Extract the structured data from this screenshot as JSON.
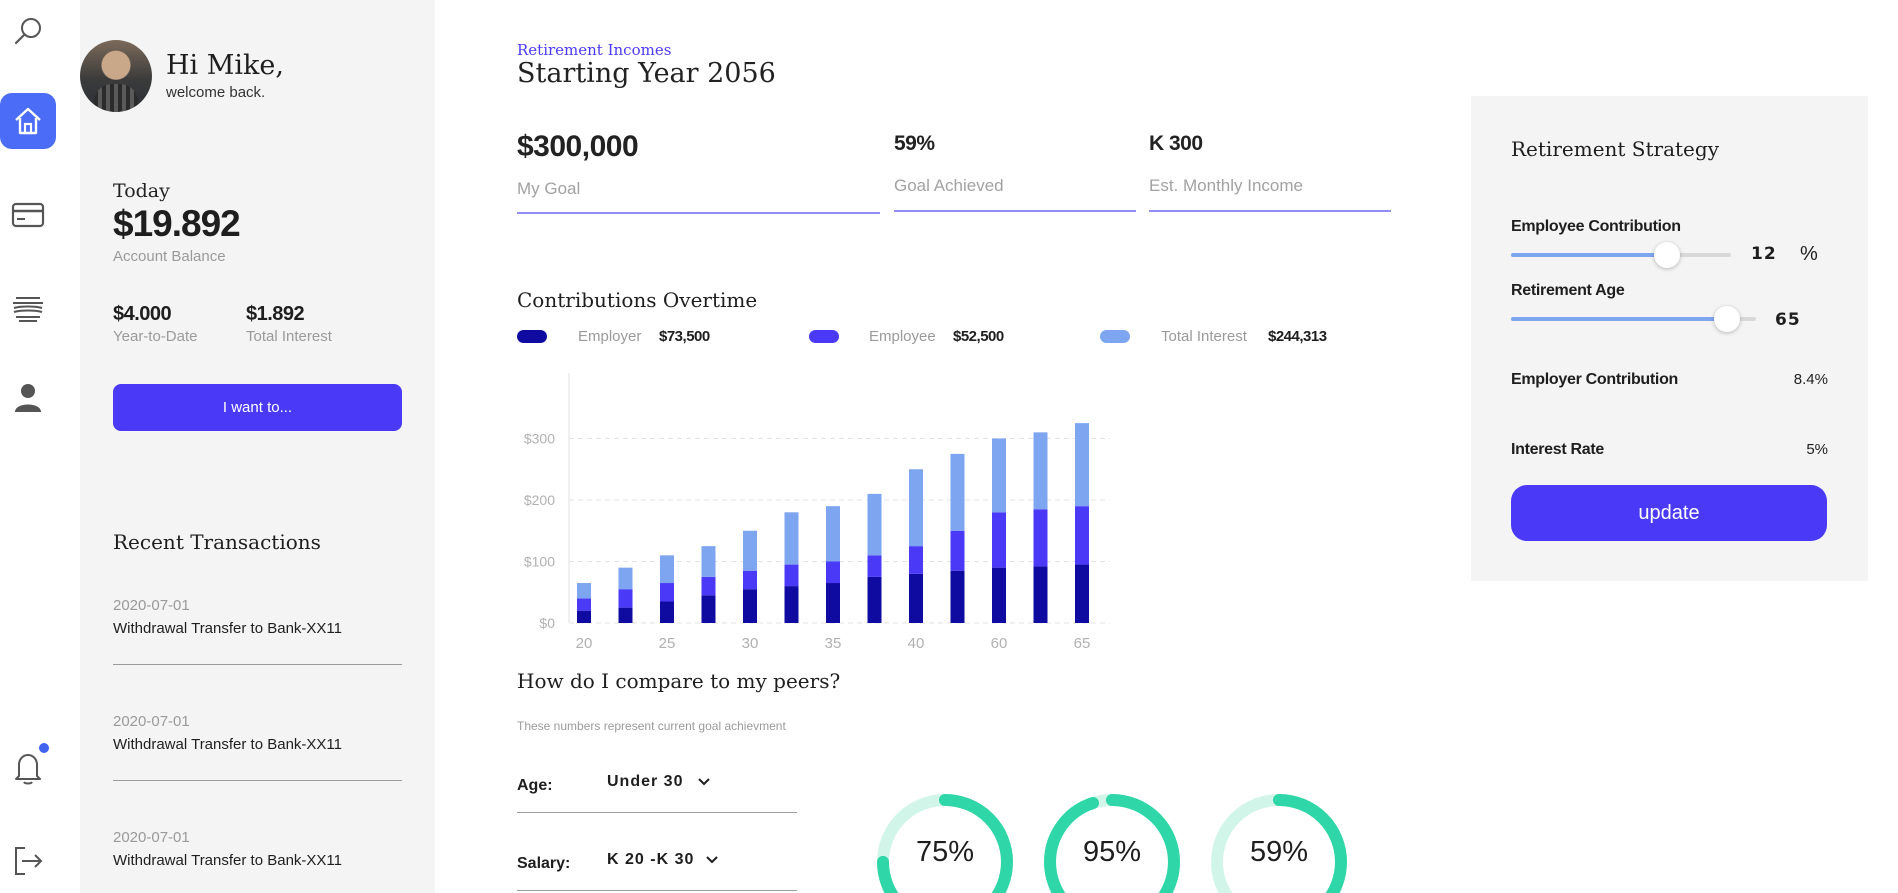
{
  "user": {
    "greeting": "Hi Mike,",
    "welcome": "welcome back."
  },
  "account": {
    "today_label": "Today",
    "balance": "$19.892",
    "balance_label": "Account Balance",
    "ytd_value": "$4.000",
    "ytd_label": "Year-to-Date",
    "interest_value": "$1.892",
    "interest_label": "Total Interest",
    "action_label": "I want to..."
  },
  "transactions": {
    "title": "Recent Transactions",
    "items": [
      {
        "date": "2020-07-01",
        "description": "Withdrawal Transfer to Bank-XX11"
      },
      {
        "date": "2020-07-01",
        "description": "Withdrawal Transfer to Bank-XX11"
      },
      {
        "date": "2020-07-01",
        "description": "Withdrawal Transfer to Bank-XX11"
      }
    ]
  },
  "header": {
    "kicker": "Retirement Incomes",
    "title": "Starting Year 2056"
  },
  "kpis": [
    {
      "value": "$300,000",
      "label": "My Goal"
    },
    {
      "value": "59%",
      "label": "Goal Achieved"
    },
    {
      "value": "K 300",
      "label": "Est. Monthly Income"
    }
  ],
  "contributions": {
    "title": "Contributions Overtime",
    "legend": [
      {
        "label": "Employer",
        "value": "$73,500",
        "color": "#0f0aa0"
      },
      {
        "label": "Employee",
        "value": "$52,500",
        "color": "#4a3af7"
      },
      {
        "label": "Total Interest",
        "value": "$244,313",
        "color": "#7ea6f0"
      }
    ]
  },
  "chart_data": {
    "type": "bar",
    "stacked": true,
    "title": "Contributions Overtime",
    "xlabel": "",
    "ylabel": "",
    "ylim": [
      0,
      400
    ],
    "yticks": [
      "$0",
      "$100",
      "$200",
      "$300"
    ],
    "ytick_values": [
      0,
      100,
      200,
      300
    ],
    "xtick_labels": [
      "20",
      "25",
      "30",
      "35",
      "40",
      "60",
      "65"
    ],
    "grid": "horizontal dashed",
    "series": [
      {
        "name": "Employer",
        "color": "#0f0aa0",
        "values": [
          20,
          25,
          35,
          45,
          55,
          60,
          65,
          75,
          80,
          85,
          90,
          92,
          95
        ]
      },
      {
        "name": "Employee",
        "color": "#4a3af7",
        "values": [
          20,
          30,
          30,
          30,
          30,
          35,
          35,
          35,
          45,
          65,
          90,
          93,
          95
        ]
      },
      {
        "name": "Total Interest",
        "color": "#7ea6f0",
        "values": [
          25,
          35,
          45,
          50,
          65,
          85,
          90,
          100,
          125,
          125,
          120,
          125,
          135
        ]
      }
    ]
  },
  "peers": {
    "title": "How do I compare to my peers?",
    "subtitle": "These numbers represent current goal achievment",
    "filters": [
      {
        "label": "Age:",
        "value": "Under 30"
      },
      {
        "label": "Salary:",
        "value": "K 20 -K 30"
      }
    ],
    "donuts": [
      {
        "label": "75%",
        "value": 0.75
      },
      {
        "label": "95%",
        "value": 0.95
      },
      {
        "label": "59%",
        "value": 0.59
      }
    ],
    "ring_color": "#2fd6a8",
    "ring_track_color": "#d2f5ea"
  },
  "strategy": {
    "title": "Retirement Strategy",
    "employee_contribution_label": "Employee Contribution",
    "employee_contribution_value": "12",
    "employee_contribution_unit": "%",
    "employee_contribution_level": 0.71,
    "retirement_age_label": "Retirement Age",
    "retirement_age_value": "65",
    "retirement_age_level": 0.88,
    "employer_contribution_label": "Employer Contribution",
    "employer_contribution_value": "8.4%",
    "interest_rate_label": "Interest Rate",
    "interest_rate_value": "5%",
    "update_label": "update"
  },
  "icons": [
    "search-icon",
    "home-icon",
    "card-icon",
    "bank-icon",
    "user-icon",
    "bell-icon",
    "logout-icon"
  ],
  "colors": {
    "accent": "#4a3af7",
    "active_nav": "#4a6cf7"
  }
}
